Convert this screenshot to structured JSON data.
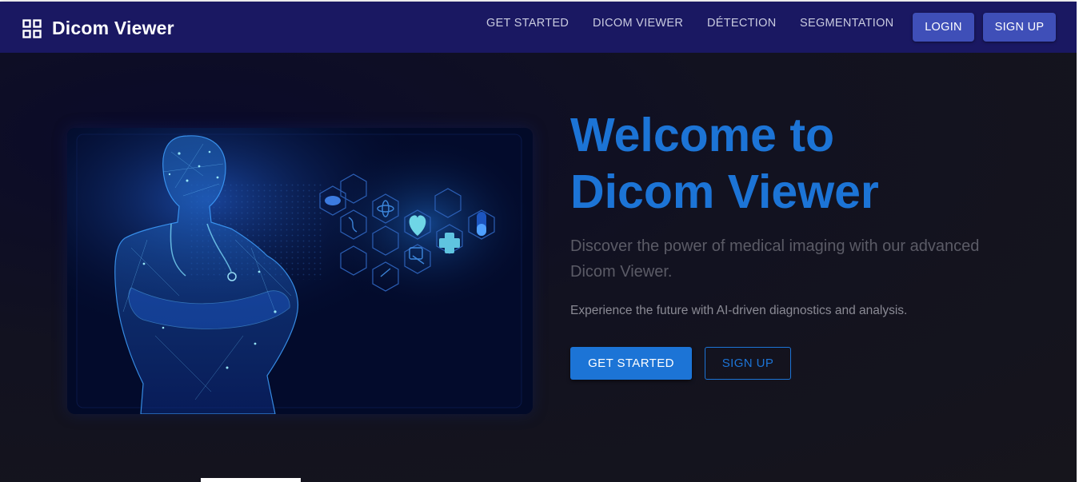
{
  "brand": {
    "title": "Dicom Viewer",
    "icon": "grid-apps-icon"
  },
  "nav": {
    "links": [
      "GET STARTED",
      "DICOM VIEWER",
      "DÉTECTION",
      "SEGMENTATION"
    ],
    "login_label": "LOGIN",
    "signup_label": "SIGN UP"
  },
  "hero": {
    "title_line1": "Welcome to",
    "title_line2": "Dicom Viewer",
    "subtitle": "Discover the power of medical imaging with our advanced Dicom Viewer.",
    "tagline": "Experience the future with AI-driven diagnostics and analysis.",
    "get_started_label": "GET STARTED",
    "signup_label": "SIGN UP",
    "image": "ai-doctor-illustration"
  },
  "colors": {
    "navbar": "#1a1862",
    "accent": "#1c74d6",
    "nav_button": "#3f4fb8",
    "background": "#15141b"
  }
}
